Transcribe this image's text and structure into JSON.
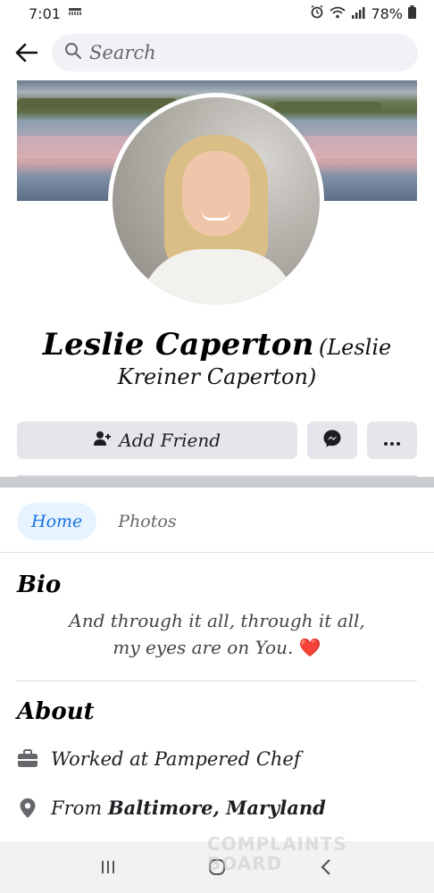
{
  "status_bar": {
    "time": "7:01",
    "battery": "78%"
  },
  "search": {
    "placeholder": "Search"
  },
  "profile": {
    "name": "Leslie Caperton",
    "alt_name_line1": "(Leslie",
    "alt_name_line2": "Kreiner Caperton)"
  },
  "actions": {
    "add_friend": "Add Friend"
  },
  "tabs": [
    {
      "label": "Home",
      "active": true
    },
    {
      "label": "Photos",
      "active": false
    }
  ],
  "bio": {
    "title": "Bio",
    "line1": "And through it all, through it all,",
    "line2": "my eyes are on You.",
    "emoji": "❤️"
  },
  "about": {
    "title": "About",
    "work_prefix": "Worked at ",
    "work_place": "Pampered Chef",
    "from_prefix": "From ",
    "from_place": "Baltimore, Maryland"
  },
  "watermark": {
    "line1": "COMPLAINTS",
    "line2": "BOARD"
  },
  "colors": {
    "accent": "#1b74e4",
    "button_bg": "#e4e6eb",
    "heart": "#e0242f"
  }
}
